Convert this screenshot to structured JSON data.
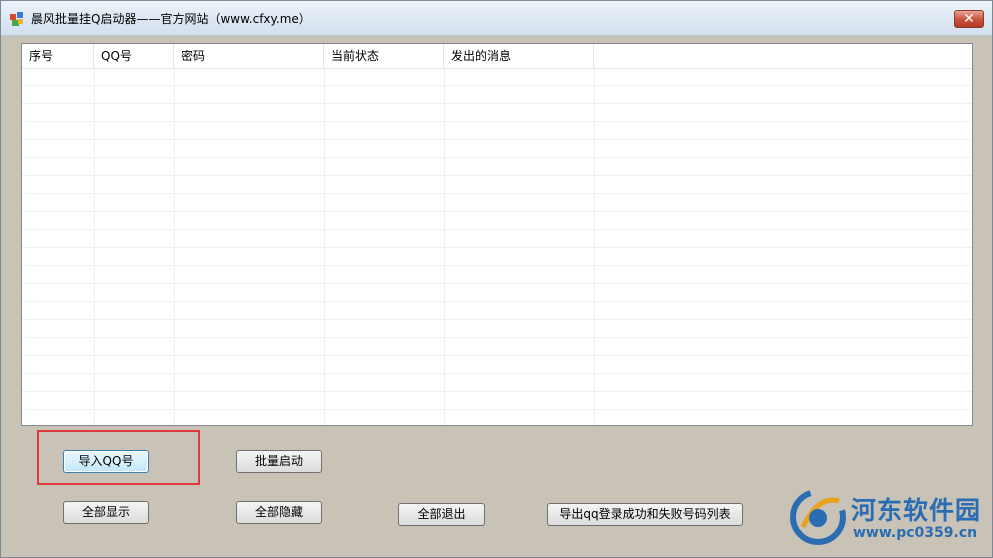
{
  "window": {
    "title": "晨风批量挂Q启动器——官方网站（www.cfxy.me）",
    "close_label": "✕"
  },
  "list": {
    "columns": [
      "序号",
      "QQ号",
      "密码",
      "当前状态",
      "发出的消息"
    ],
    "rows": []
  },
  "buttons": {
    "import_qq": "导入QQ号",
    "batch_start": "批量启动",
    "show_all": "全部显示",
    "hide_all": "全部隐藏",
    "exit_all": "全部退出",
    "export_list": "导出qq登录成功和失败号码列表"
  },
  "watermark": {
    "name": "河东软件园",
    "url": "www.pc0359.cn"
  },
  "colors": {
    "window_bg": "#c9c2b7",
    "highlight": "#e03a3a",
    "watermark": "#2b6db2"
  }
}
